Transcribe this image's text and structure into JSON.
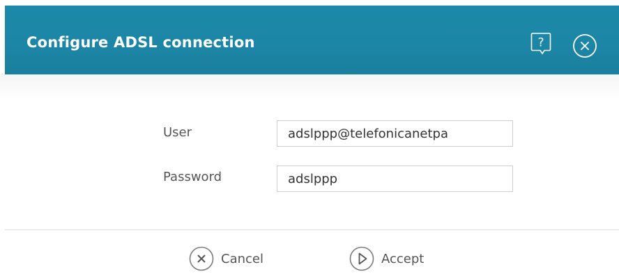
{
  "dialog": {
    "title": "Configure ADSL connection",
    "header_icons": [
      {
        "name": "help-icon",
        "symbol": "?"
      },
      {
        "name": "close-icon",
        "symbol": "×"
      }
    ],
    "header_color": "#1c86a6"
  },
  "form": {
    "user": {
      "label": "User",
      "value": "adslppp@telefonicanetpa"
    },
    "password": {
      "label": "Password",
      "value": "adslppp"
    }
  },
  "footer": {
    "cancel_label": "Cancel",
    "accept_label": "Accept"
  }
}
